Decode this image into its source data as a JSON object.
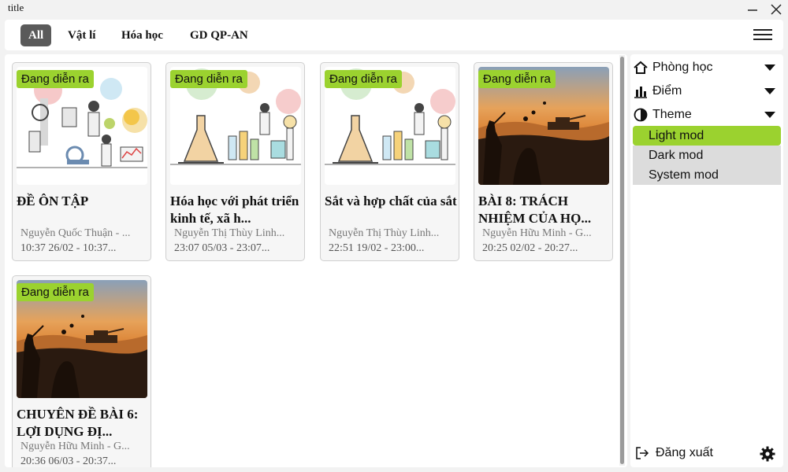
{
  "window": {
    "title": "title"
  },
  "tabs": [
    {
      "label": "All",
      "active": true
    },
    {
      "label": "Vật lí",
      "active": false
    },
    {
      "label": "Hóa học",
      "active": false
    },
    {
      "label": "GD QP-AN",
      "active": false
    }
  ],
  "cards": [
    {
      "badge": "Đang diễn ra",
      "title": "ĐỀ ÔN TẬP",
      "author": "Nguyễn Quốc Thuận - ...",
      "time": "10:37 26/02 - 10:37...",
      "image": "science-lab-illustration"
    },
    {
      "badge": "Đang diễn ra",
      "title": "Hóa học với phát triển kinh tế, xã h...",
      "author": "Nguyễn Thị Thùy Linh...",
      "time": "23:07 05/03 - 23:07...",
      "image": "chemistry-lab-illustration"
    },
    {
      "badge": "Đang diễn ra",
      "title": "Sắt và hợp chất của sắt",
      "author": "Nguyễn Thị Thùy Linh...",
      "time": "22:51 19/02 - 23:00...",
      "image": "chemistry-lab-illustration"
    },
    {
      "badge": "Đang diễn ra",
      "title": "BÀI 8: TRÁCH NHIỆM CỦA HỌ...",
      "author": "Nguyễn Hữu Minh - G...",
      "time": "20:25 02/02 - 20:27...",
      "image": "military-silhouette-illustration"
    },
    {
      "badge": "Đang diễn ra",
      "title": "CHUYÊN ĐỀ BÀI 6: LỢI DỤNG ĐỊ...",
      "author": "Nguyễn Hữu Minh - G...",
      "time": "20:36 06/03 - 20:37...",
      "image": "military-silhouette-illustration"
    }
  ],
  "sidebar": {
    "items": [
      {
        "label": "Phòng học",
        "icon": "home-icon"
      },
      {
        "label": "Điểm",
        "icon": "bar-chart-icon"
      },
      {
        "label": "Theme",
        "icon": "contrast-icon"
      }
    ],
    "theme_options": [
      {
        "label": "Light mod",
        "active": true
      },
      {
        "label": "Dark mod",
        "active": false
      },
      {
        "label": "System mod",
        "active": false
      }
    ],
    "logout_label": "Đăng xuất"
  },
  "colors": {
    "accent": "#9bd22f",
    "active_tab": "#5a5a5a"
  }
}
